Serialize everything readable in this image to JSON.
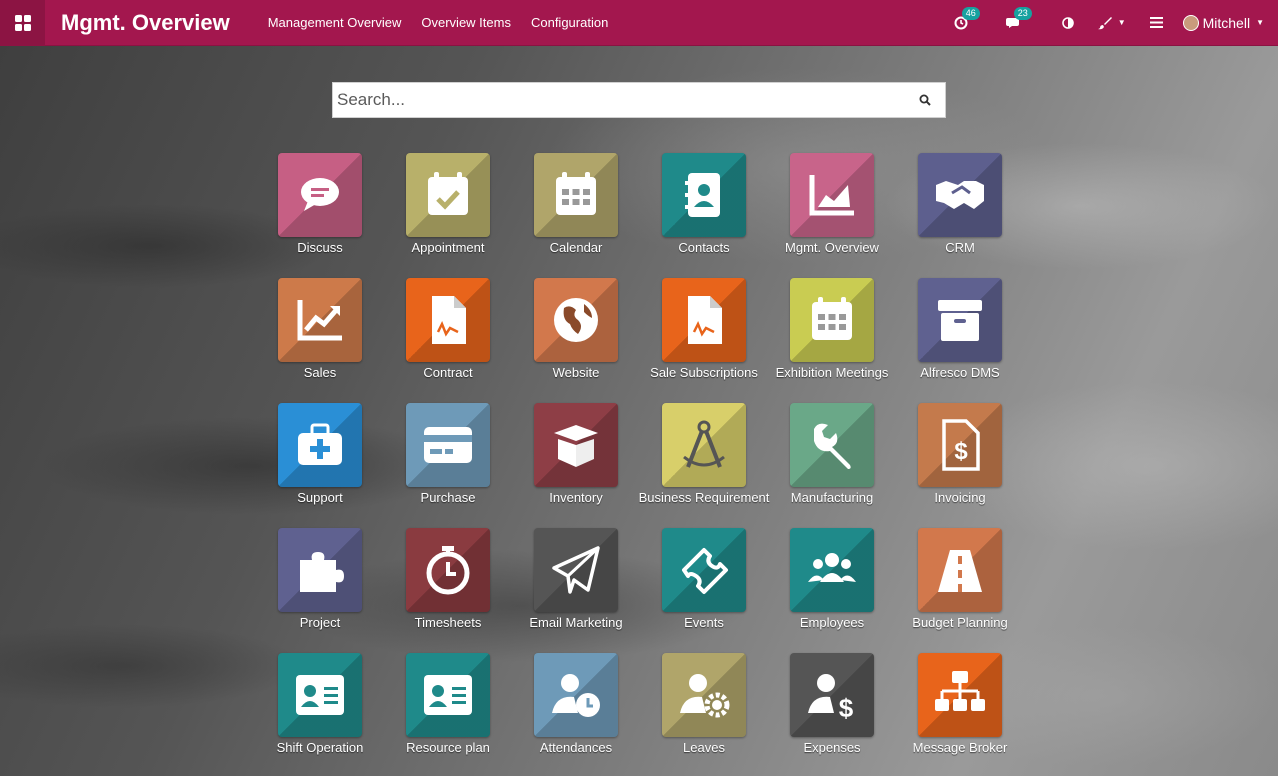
{
  "navbar": {
    "title": "Mgmt. Overview",
    "menu": [
      "Management Overview",
      "Overview Items",
      "Configuration"
    ],
    "activity_count": "46",
    "messages_count": "23",
    "user": "Mitchell"
  },
  "search": {
    "placeholder": "Search..."
  },
  "apps": [
    {
      "label": "Discuss",
      "color": "#c65f84",
      "icon": "chat-icon"
    },
    {
      "label": "Appointment",
      "color": "#b8b06a",
      "icon": "calendar-check-icon"
    },
    {
      "label": "Calendar",
      "color": "#b0a56a",
      "icon": "calendar-icon"
    },
    {
      "label": "Contacts",
      "color": "#1f8a8a",
      "icon": "address-book-icon"
    },
    {
      "label": "Mgmt. Overview",
      "color": "#c8648a",
      "icon": "area-chart-icon"
    },
    {
      "label": "CRM",
      "color": "#5d5f8e",
      "icon": "handshake-icon"
    },
    {
      "label": "Sales",
      "color": "#cd7a4a",
      "icon": "line-chart-icon"
    },
    {
      "label": "Contract",
      "color": "#e8641b",
      "icon": "file-signature-icon"
    },
    {
      "label": "Website",
      "color": "#d2784c",
      "icon": "globe-icon"
    },
    {
      "label": "Sale Subscriptions",
      "color": "#e8641b",
      "icon": "file-signature-icon"
    },
    {
      "label": "Exhibition Meetings",
      "color": "#c9cc52",
      "icon": "calendar-icon"
    },
    {
      "label": "Alfresco DMS",
      "color": "#5f6190",
      "icon": "archive-icon"
    },
    {
      "label": "Support",
      "color": "#2a8fd6",
      "icon": "medkit-icon"
    },
    {
      "label": "Purchase",
      "color": "#6e9ab8",
      "icon": "credit-card-icon"
    },
    {
      "label": "Inventory",
      "color": "#8e3e46",
      "icon": "box-open-icon"
    },
    {
      "label": "Business Requirement",
      "color": "#d8cf6a",
      "icon": "compass-drafting-icon"
    },
    {
      "label": "Manufacturing",
      "color": "#6aa888",
      "icon": "wrench-icon"
    },
    {
      "label": "Invoicing",
      "color": "#c47a4c",
      "icon": "invoice-dollar-icon"
    },
    {
      "label": "Project",
      "color": "#5f6190",
      "icon": "puzzle-icon"
    },
    {
      "label": "Timesheets",
      "color": "#8a3b40",
      "icon": "stopwatch-icon"
    },
    {
      "label": "Email Marketing",
      "color": "#555555",
      "icon": "paper-plane-icon"
    },
    {
      "label": "Events",
      "color": "#1f8a8a",
      "icon": "ticket-icon"
    },
    {
      "label": "Employees",
      "color": "#1f8a8a",
      "icon": "users-icon"
    },
    {
      "label": "Budget Planning",
      "color": "#d2784c",
      "icon": "road-icon"
    },
    {
      "label": "Shift Operation",
      "color": "#1f8a8a",
      "icon": "id-card-icon"
    },
    {
      "label": "Resource plan",
      "color": "#1f8a8a",
      "icon": "id-card-icon"
    },
    {
      "label": "Attendances",
      "color": "#6e9ab8",
      "icon": "user-clock-icon"
    },
    {
      "label": "Leaves",
      "color": "#b0a56a",
      "icon": "user-gear-icon"
    },
    {
      "label": "Expenses",
      "color": "#555555",
      "icon": "user-dollar-icon"
    },
    {
      "label": "Message Broker",
      "color": "#e8641b",
      "icon": "sitemap-icon"
    }
  ]
}
